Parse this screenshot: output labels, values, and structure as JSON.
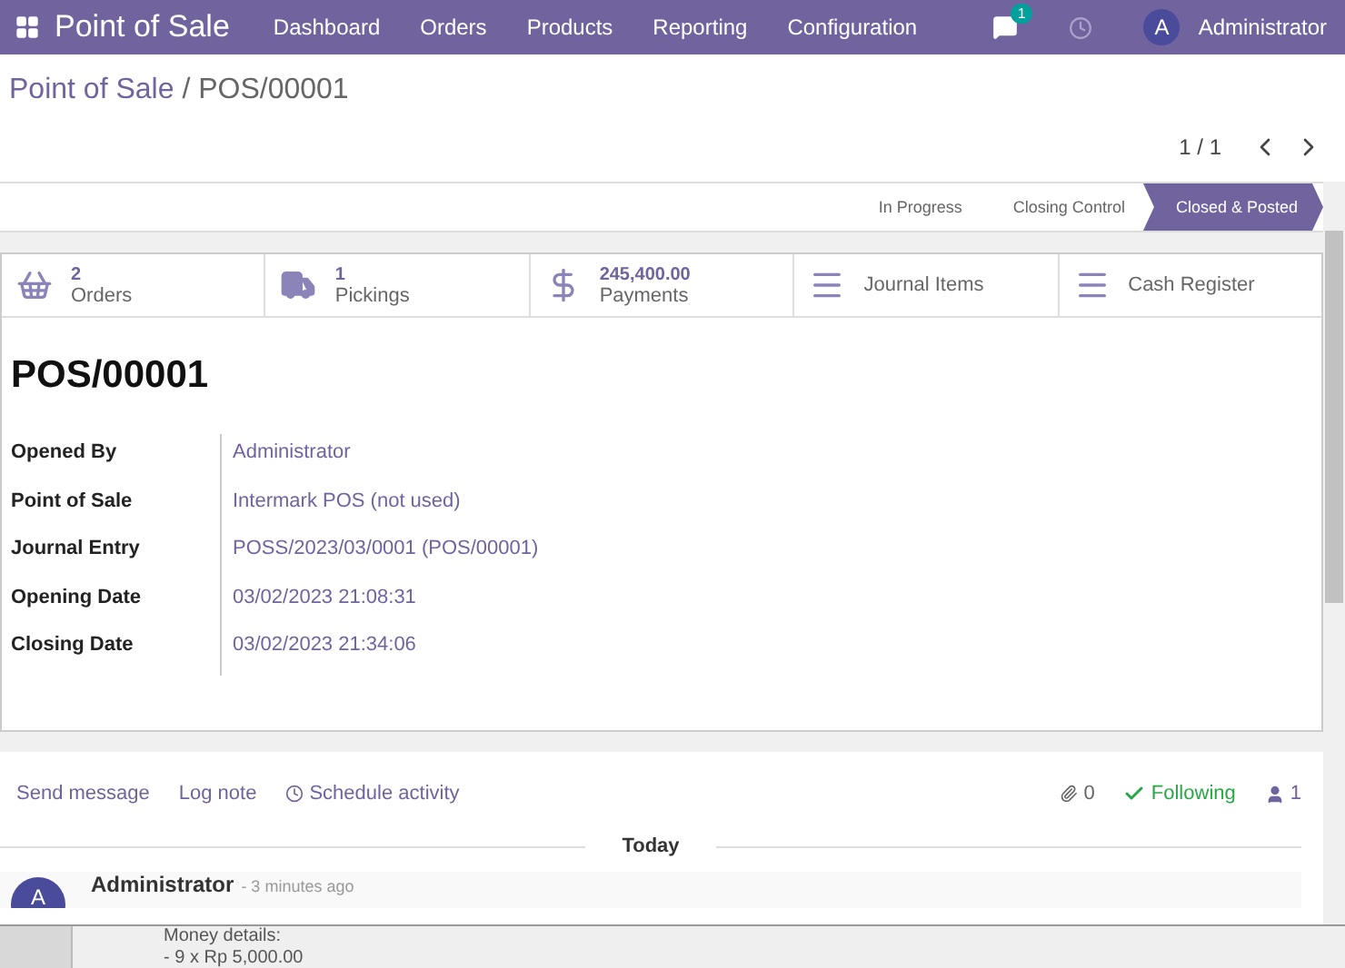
{
  "navbar": {
    "app_name": "Point of Sale",
    "menu": [
      "Dashboard",
      "Orders",
      "Products",
      "Reporting",
      "Configuration"
    ],
    "notification_count": "1",
    "user": {
      "initial": "A",
      "name": "Administrator"
    }
  },
  "breadcrumb": {
    "parent": "Point of Sale",
    "separator": "/",
    "current": "POS/00001"
  },
  "pager": "1 / 1",
  "stages": [
    {
      "label": "In Progress",
      "selected": false
    },
    {
      "label": "Closing Control",
      "selected": false
    },
    {
      "label": "Closed & Posted",
      "selected": true
    }
  ],
  "smart_buttons": [
    {
      "kind": "orders",
      "value": "2",
      "label": "Orders"
    },
    {
      "kind": "pickings",
      "value": "1",
      "label": "Pickings"
    },
    {
      "kind": "payments",
      "value": "245,400.00",
      "label": "Payments"
    },
    {
      "kind": "journal",
      "label": "Journal Items"
    },
    {
      "kind": "journal",
      "label": "Cash Register"
    }
  ],
  "title": "POS/00001",
  "fields": [
    {
      "label": "Opened By",
      "value": "Administrator"
    },
    {
      "label": "Point of Sale",
      "value": "Intermark POS (not used)"
    },
    {
      "label": "Journal Entry",
      "value": "POSS/2023/03/0001 (POS/00001)"
    },
    {
      "label": "Opening Date",
      "value": "03/02/2023 21:08:31"
    },
    {
      "label": "Closing Date",
      "value": "03/02/2023 21:34:06"
    }
  ],
  "chatter": {
    "actions": [
      {
        "kind": "link",
        "label": "Send message"
      },
      {
        "kind": "link",
        "label": "Log note"
      },
      {
        "kind": "activity",
        "label": "Schedule activity"
      }
    ],
    "attachments": "0",
    "following": "Following",
    "followers": "1",
    "separator": "Today",
    "message": {
      "initial": "A",
      "author": "Administrator",
      "time": "- 3 minutes ago",
      "lines": [
        "Money details:",
        "- 9 x Rp 5,000.00"
      ]
    }
  }
}
